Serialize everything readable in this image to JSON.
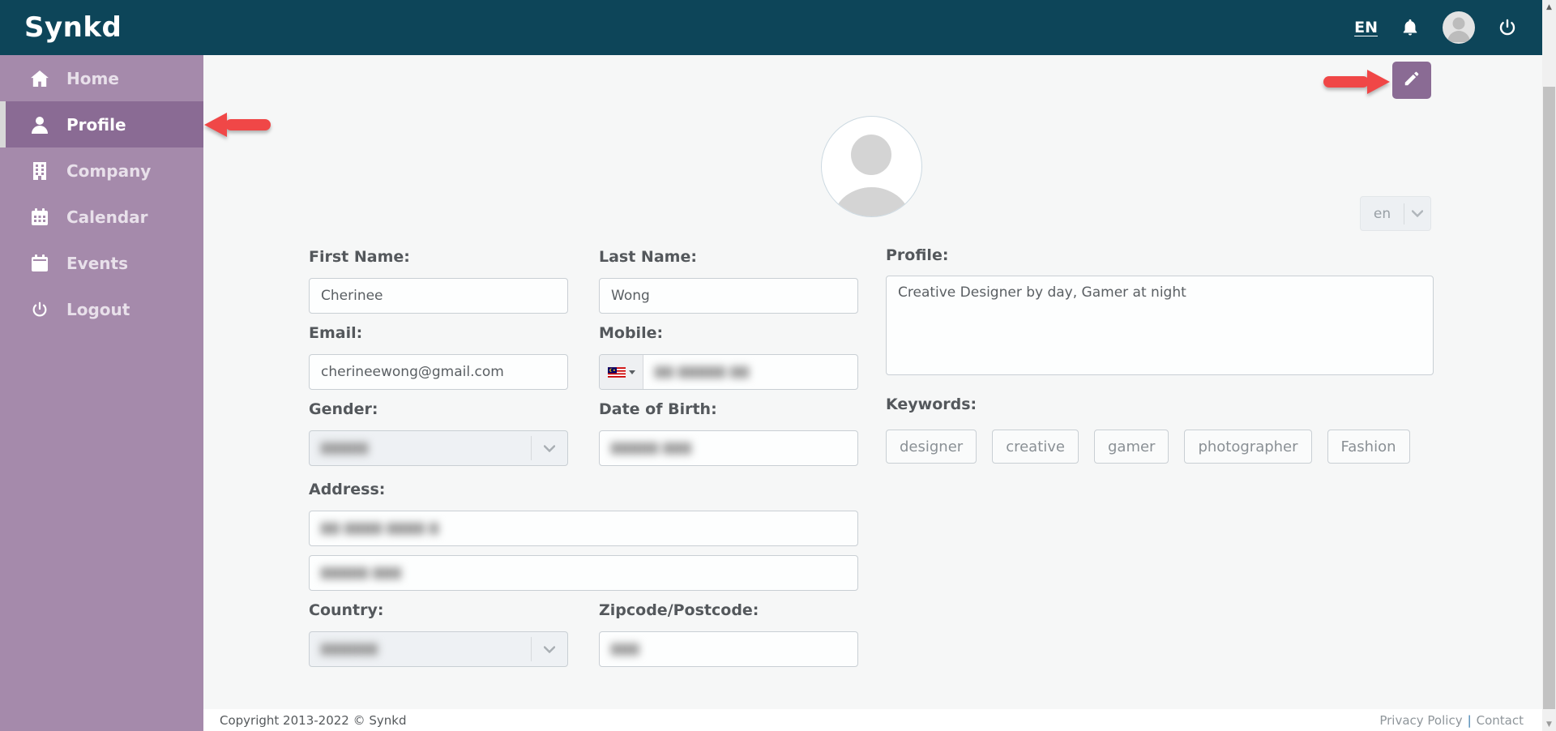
{
  "colors": {
    "topbar": "#0d4559",
    "sidebar": "#a58aab",
    "sidebar_active": "#8a6b94",
    "edit_button": "#8a6b94",
    "arrow_red": "#f04747",
    "page_bg": "#f6f7f7"
  },
  "topbar": {
    "logo": "Synkd",
    "language": "EN",
    "icons": [
      "bell-icon",
      "avatar",
      "power-icon"
    ]
  },
  "sidebar": {
    "items": [
      {
        "label": "Home",
        "icon": "home-icon",
        "active": false
      },
      {
        "label": "Profile",
        "icon": "user-icon",
        "active": true
      },
      {
        "label": "Company",
        "icon": "building-icon",
        "active": false
      },
      {
        "label": "Calendar",
        "icon": "calendar-icon",
        "active": false
      },
      {
        "label": "Events",
        "icon": "events-icon",
        "active": false
      },
      {
        "label": "Logout",
        "icon": "power-icon",
        "active": false
      }
    ]
  },
  "profile_page": {
    "language_selector": {
      "value": "en"
    },
    "fields": {
      "first_name": {
        "label": "First Name:",
        "value": "Cherinee"
      },
      "last_name": {
        "label": "Last Name:",
        "value": "Wong"
      },
      "email": {
        "label": "Email:",
        "value": "cherineewong@gmail.com"
      },
      "mobile": {
        "label": "Mobile:",
        "flag": "malaysia-flag-icon",
        "value_blurred": "▇▇ ▇▇▇▇▇ ▇▇"
      },
      "gender": {
        "label": "Gender:",
        "value_blurred": "▇▇▇▇▇"
      },
      "date_of_birth": {
        "label": "Date of Birth:",
        "value_blurred": "▇▇▇▇▇ ▇▇▇"
      },
      "address_line1": {
        "value_blurred": "▇▇ ▇▇▇▇ ▇▇▇▇ ▇"
      },
      "address_line2": {
        "value_blurred": "▇▇▇▇▇ ▇▇▇"
      },
      "address": {
        "label": "Address:"
      },
      "country": {
        "label": "Country:",
        "value_blurred": "▇▇▇▇▇▇"
      },
      "zipcode": {
        "label": "Zipcode/Postcode:",
        "value_blurred": "▇▇▇"
      },
      "profile": {
        "label": "Profile:",
        "value": "Creative Designer by day, Gamer at night"
      },
      "keywords": {
        "label": "Keywords:"
      }
    },
    "keywords": [
      "designer",
      "creative",
      "gamer",
      "photographer",
      "Fashion"
    ]
  },
  "footer": {
    "copyright": "Copyright 2013-2022 © Synkd",
    "privacy": "Privacy Policy",
    "separator": "|",
    "contact": "Contact"
  }
}
